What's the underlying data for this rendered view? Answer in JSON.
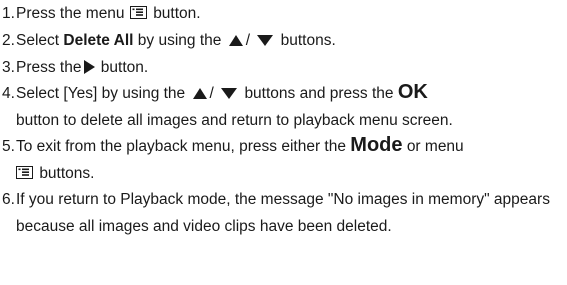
{
  "steps": [
    {
      "num": "1.",
      "a": "Press the menu",
      "b": "button."
    },
    {
      "num": "2.",
      "a": "Select",
      "bold": "Delete All",
      "b": "by using the",
      "sep": "/",
      "c": "buttons."
    },
    {
      "num": "3.",
      "a": "Press the",
      "b": "button."
    },
    {
      "num": "4.",
      "a": "Select [Yes] by using the",
      "sep": "/",
      "b": "buttons and press the",
      "ok": "OK",
      "c": "button to delete all images and return to playback menu screen."
    },
    {
      "num": "5.",
      "a": "To exit from the playback menu, press either the",
      "mode": "Mode",
      "b": "or menu",
      "c": "buttons."
    },
    {
      "num": "6.",
      "text": "If you return to Playback mode, the message \"No images in memory\" appears because all images and video clips have been deleted."
    }
  ],
  "icons": {
    "menu": "menu-list-icon",
    "up": "triangle-up-icon",
    "down": "triangle-down-icon",
    "right": "triangle-right-icon"
  }
}
